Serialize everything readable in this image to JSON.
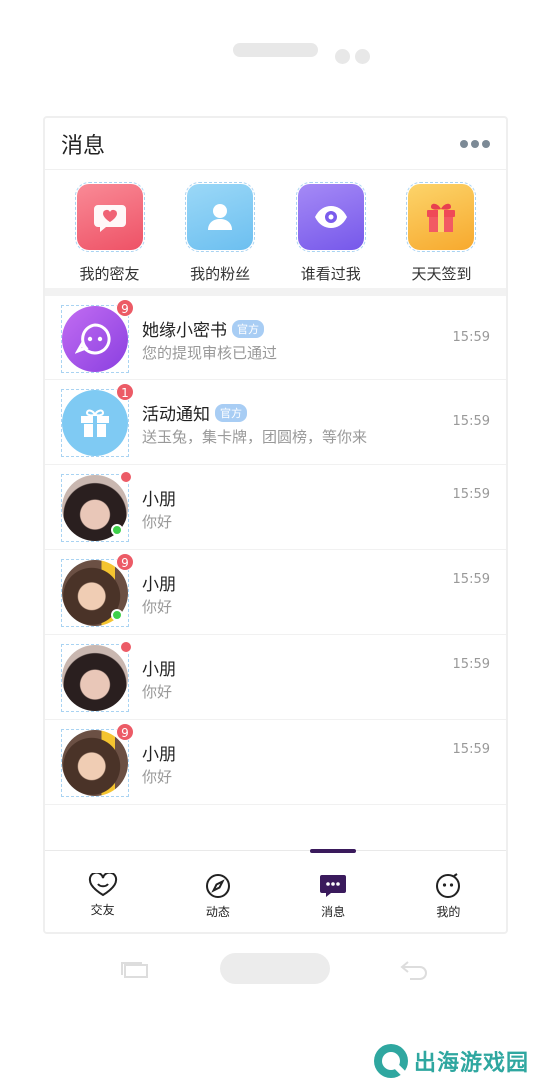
{
  "header": {
    "title": "消息"
  },
  "quick_actions": [
    {
      "label": "我的密友",
      "icon": "heart-chat-icon",
      "color": "#f26a78"
    },
    {
      "label": "我的粉丝",
      "icon": "user-icon",
      "color": "#7ec8f2"
    },
    {
      "label": "谁看过我",
      "icon": "eye-icon",
      "color": "#8a6ef0"
    },
    {
      "label": "天天签到",
      "icon": "gift-icon",
      "color": "#f8b640"
    }
  ],
  "messages": [
    {
      "name": "她缘小密书",
      "tag": "官方",
      "preview": "您的提现审核已通过",
      "time": "15:59",
      "badge": "9"
    },
    {
      "name": "活动通知",
      "tag": "官方",
      "preview": "送玉兔，集卡牌，团圆榜，等你来",
      "time": "15:59",
      "badge": "1"
    },
    {
      "name": "小朋",
      "preview": "你好",
      "time": "15:59"
    },
    {
      "name": "小朋",
      "preview": "你好",
      "time": "15:59",
      "badge": "9"
    },
    {
      "name": "小朋",
      "preview": "你好",
      "time": "15:59"
    },
    {
      "name": "小朋",
      "preview": "你好",
      "time": "15:59",
      "badge": "9"
    }
  ],
  "tabs": [
    {
      "label": "交友",
      "icon": "heart-icon"
    },
    {
      "label": "动态",
      "icon": "compass-icon"
    },
    {
      "label": "消息",
      "icon": "message-icon",
      "active": true
    },
    {
      "label": "我的",
      "icon": "smile-icon"
    }
  ],
  "watermark": {
    "text": "出海游戏园"
  },
  "colors": {
    "accent": "#3a1a5c",
    "badge": "#ec5b66",
    "online": "#3ed14a",
    "official_tag": "#a8cdf4"
  }
}
